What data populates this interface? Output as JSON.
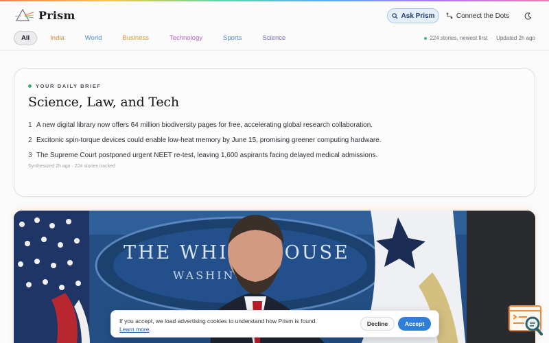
{
  "app": {
    "name": "Prism"
  },
  "header": {
    "ask_label": "Ask Prism",
    "connect_label": "Connect the Dots",
    "theme_icon": "moon-icon"
  },
  "tabs": [
    {
      "label": "All",
      "active": true
    },
    {
      "label": "India",
      "color": "#d8893a"
    },
    {
      "label": "World",
      "color": "#4d8ec4"
    },
    {
      "label": "Business",
      "color": "#d9972c"
    },
    {
      "label": "Technology",
      "color": "#b55fc6"
    },
    {
      "label": "Sports",
      "color": "#4f88c6"
    },
    {
      "label": "Science",
      "color": "#6f6bc8"
    }
  ],
  "stories_meta": {
    "count_text": "224 stories, newest first",
    "separator": "·",
    "updated_text": "Updated 2h ago"
  },
  "brief": {
    "label": "YOUR DAILY BRIEF",
    "title": "Science, Law, and Tech",
    "items": [
      {
        "num": "1",
        "text": "A new digital library now offers 64 million biodiversity pages for free, accelerating global research collaboration."
      },
      {
        "num": "2",
        "text": "Excitonic spin-torque devices could enable low-heat memory by June 15, promising greener computing hardware."
      },
      {
        "num": "3",
        "text": "The Supreme Court postponed urgent NEET re-test, leaving 1,600 aspirants facing delayed medical admissions."
      }
    ],
    "footer": "Synthesized 2h ago · 224 stories tracked"
  },
  "story_image": {
    "sign_line1": "THE WHITE HOUSE",
    "sign_line2": "WASHINGTON"
  },
  "cookie": {
    "text": "If you accept, we load advertising cookies to understand how Prism is found.",
    "link_label": "Learn more",
    "link_suffix": ".",
    "decline_label": "Decline",
    "accept_label": "Accept"
  },
  "colors": {
    "accent": "#2f7fd8",
    "ask_bg": "#e5eefb",
    "live_dot": "#3fb27a"
  }
}
